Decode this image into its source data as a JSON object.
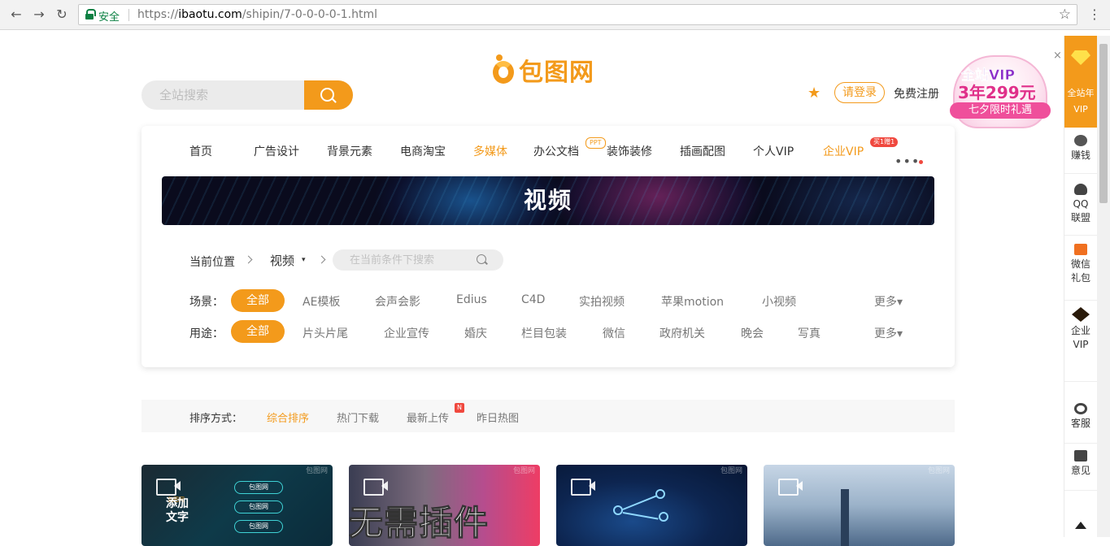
{
  "browser": {
    "back_icon": "←",
    "forward_icon": "→",
    "reload_icon": "↻",
    "secure_label": "安全",
    "url_scheme": "https://",
    "url_domain": "ibaotu.com",
    "url_path": "/shipin/7-0-0-0-0-1.html",
    "bookmark_icon": "☆",
    "menu_icon": "⋮"
  },
  "header": {
    "logo_text": "包图网",
    "search_placeholder": "全站搜索",
    "login_label": "请登录",
    "register_label": "免费注册",
    "fav_icon": "★"
  },
  "promo": {
    "line1": "全站VIP",
    "line2": "3年299元",
    "line3": "七夕限时礼遇",
    "close_icon": "×"
  },
  "nav": {
    "items": [
      {
        "label": "首页"
      },
      {
        "label": "广告设计"
      },
      {
        "label": "背景元素"
      },
      {
        "label": "电商淘宝"
      },
      {
        "label": "多媒体",
        "active": true
      },
      {
        "label": "办公文档",
        "badge": "PPT"
      },
      {
        "label": "装饰装修"
      },
      {
        "label": "插画配图"
      },
      {
        "label": "个人VIP"
      },
      {
        "label": "企业VIP",
        "active": true,
        "badge": "买1赠1"
      }
    ],
    "more_icon": "•••"
  },
  "banner": {
    "title": "视频"
  },
  "breadcrumb": {
    "label": "当前位置",
    "current": "视频",
    "caret": "▾",
    "search_placeholder": "在当前条件下搜索"
  },
  "filters": {
    "scene": {
      "label": "场景：",
      "selected": "全部",
      "options": [
        "AE模板",
        "会声会影",
        "Edius",
        "C4D",
        "实拍视频",
        "苹果motion",
        "小视频"
      ],
      "more": "更多▾"
    },
    "usage": {
      "label": "用途：",
      "selected": "全部",
      "options": [
        "片头片尾",
        "企业宣传",
        "婚庆",
        "栏目包装",
        "微信",
        "政府机关",
        "晚会",
        "写真"
      ],
      "more": "更多▾"
    }
  },
  "sort": {
    "label": "排序方式：",
    "options": [
      {
        "label": "综合排序",
        "active": true
      },
      {
        "label": "热门下载"
      },
      {
        "label": "最新上传",
        "badge": "N"
      },
      {
        "label": "昨日热图"
      }
    ]
  },
  "thumbs": [
    {
      "watermark": "包图网",
      "overlay_small": "包图网",
      "overlay": "添加文字",
      "tags": [
        "包图网",
        "包图网",
        "包图网"
      ]
    },
    {
      "watermark": "包图网",
      "overlay": "无需插件"
    },
    {
      "watermark": "包图网"
    },
    {
      "watermark": "包图网"
    }
  ],
  "sidebar": {
    "vip": "全站年VIP",
    "items": [
      "赚钱",
      "QQ联盟",
      "微信礼包",
      "企业VIP",
      "客服",
      "意见"
    ]
  },
  "colors": {
    "accent": "#f39a1b",
    "badge_red": "#f0483e",
    "secure_green": "#0b8043"
  }
}
